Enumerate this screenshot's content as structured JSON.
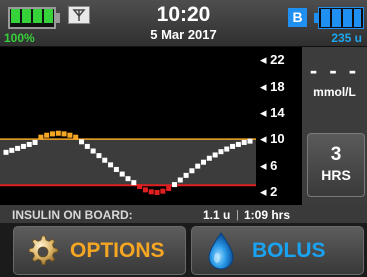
{
  "status": {
    "battery_percent": "100%",
    "battery_level": 1.0,
    "time": "10:20",
    "date": "5 Mar 2017",
    "bluetooth_badge": "B",
    "insulin_remaining": "235 u",
    "colors": {
      "battery": "#35d23a",
      "insulin": "#1f8ff2"
    }
  },
  "cgm": {
    "glucose_display": "- - -",
    "units": "mmol/L",
    "time_range": {
      "value": "3",
      "label": "HRS"
    }
  },
  "chart_data": {
    "type": "scatter",
    "yticks": [
      "22",
      "18",
      "14",
      "10",
      "6",
      "2"
    ],
    "ylim": [
      0,
      24
    ],
    "high_target": 10,
    "low_target": 3,
    "colors": {
      "normal": "#ffffff",
      "high": "#f5a623",
      "low": "#e02020",
      "high_line": "#f5a623",
      "low_line": "#e02020"
    },
    "points": [
      [
        0,
        8.0
      ],
      [
        1,
        8.3
      ],
      [
        2,
        8.6
      ],
      [
        3,
        8.9
      ],
      [
        4,
        9.2
      ],
      [
        5,
        9.5
      ],
      [
        6,
        10.3
      ],
      [
        7,
        10.6
      ],
      [
        8,
        10.8
      ],
      [
        9,
        10.9
      ],
      [
        10,
        10.8
      ],
      [
        11,
        10.6
      ],
      [
        12,
        10.3
      ],
      [
        13,
        9.6
      ],
      [
        14,
        8.9
      ],
      [
        15,
        8.2
      ],
      [
        16,
        7.5
      ],
      [
        17,
        6.8
      ],
      [
        18,
        6.1
      ],
      [
        19,
        5.4
      ],
      [
        20,
        4.7
      ],
      [
        21,
        4.0
      ],
      [
        22,
        3.4
      ],
      [
        23,
        2.8
      ],
      [
        24,
        2.3
      ],
      [
        25,
        2.0
      ],
      [
        26,
        1.9
      ],
      [
        27,
        2.1
      ],
      [
        28,
        2.5
      ],
      [
        29,
        3.1
      ],
      [
        30,
        3.8
      ],
      [
        31,
        4.5
      ],
      [
        32,
        5.2
      ],
      [
        33,
        5.9
      ],
      [
        34,
        6.5
      ],
      [
        35,
        7.1
      ],
      [
        36,
        7.6
      ],
      [
        37,
        8.1
      ],
      [
        38,
        8.5
      ],
      [
        39,
        8.9
      ],
      [
        40,
        9.2
      ],
      [
        41,
        9.5
      ],
      [
        42,
        9.7
      ]
    ]
  },
  "insulin_on_board": {
    "label": "INSULIN ON BOARD:",
    "amount": "1.1 u",
    "separator": "|",
    "duration": "1:09 hrs"
  },
  "buttons": {
    "options": {
      "label": "OPTIONS",
      "color": "#f5a623",
      "icon": "gear-icon"
    },
    "bolus": {
      "label": "BOLUS",
      "color": "#1aa3f0",
      "icon": "drop-icon"
    }
  }
}
